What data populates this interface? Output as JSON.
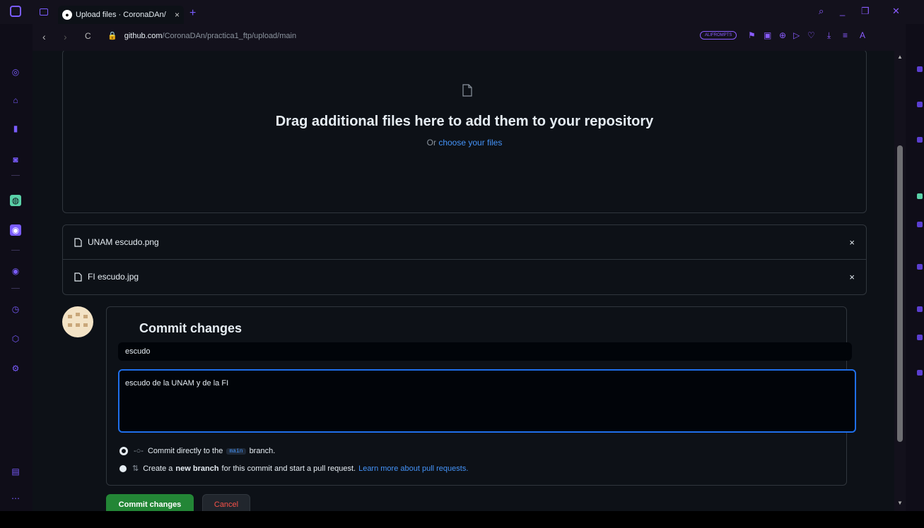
{
  "browser": {
    "tab_title": "Upload files · CoronaDAn/",
    "tab_close": "×",
    "new_tab": "+",
    "url_lock": "🔒",
    "url_domain": "github.com",
    "url_path": "/CoronaDAn/practica1_ftp/upload/main",
    "ext_pill": "ALIFROMPTS",
    "nav_back": "‹",
    "nav_forward": "›",
    "nav_reload": "C"
  },
  "dropzone": {
    "title": "Drag additional files here to add them to your repository",
    "sub_prefix": "Or",
    "sub_link": "choose your files"
  },
  "files": [
    {
      "name": "UNAM escudo.png",
      "remove": "×"
    },
    {
      "name": "FI escudo.jpg",
      "remove": "×"
    }
  ],
  "commit": {
    "title": "Commit changes",
    "summary": "escudo",
    "description": "escudo de la UNAM y de la FI",
    "option1_prefix": "Commit directly to the",
    "option1_branch": "main",
    "option1_suffix": "branch.",
    "option2_prefix": "Create a",
    "option2_bold": "new branch",
    "option2_suffix": "for this commit and start a pull request.",
    "option2_link": "Learn more about pull requests.",
    "commit_button": "Commit changes",
    "cancel_button": "Cancel"
  },
  "colors": {
    "accent": "#8a5cff",
    "link": "#4493f8",
    "primary_button": "#238636",
    "danger_text": "#f85149"
  }
}
